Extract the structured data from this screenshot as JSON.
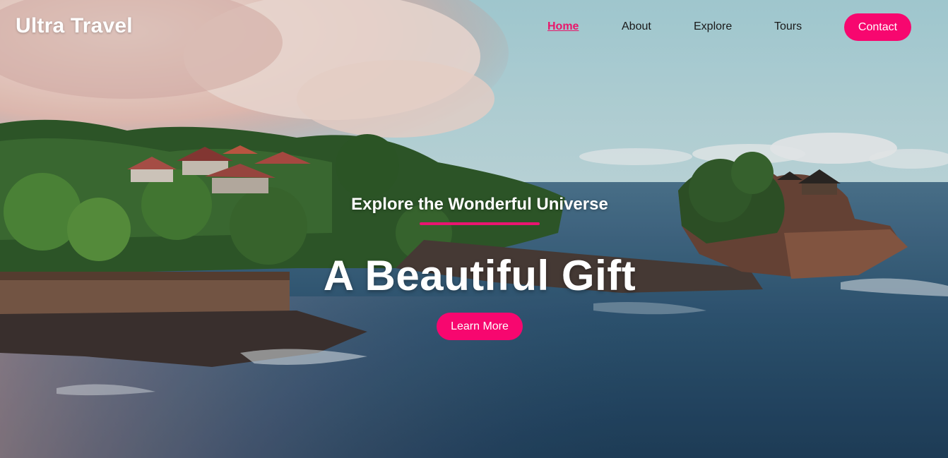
{
  "site": {
    "logo": "Ultra Travel"
  },
  "nav": {
    "items": [
      {
        "label": "Home",
        "active": true
      },
      {
        "label": "About",
        "active": false
      },
      {
        "label": "Explore",
        "active": false
      },
      {
        "label": "Tours",
        "active": false
      }
    ],
    "contact_label": "Contact"
  },
  "hero": {
    "subtitle": "Explore the Wonderful Universe",
    "headline": "A Beautiful Gift",
    "cta_label": "Learn More",
    "background_description_icon": "coastal-temple-photo"
  },
  "colors": {
    "accent": "#f7076f",
    "active_link": "#e8176b",
    "text_light": "#ffffff",
    "text_dark": "#1a1a1a"
  }
}
